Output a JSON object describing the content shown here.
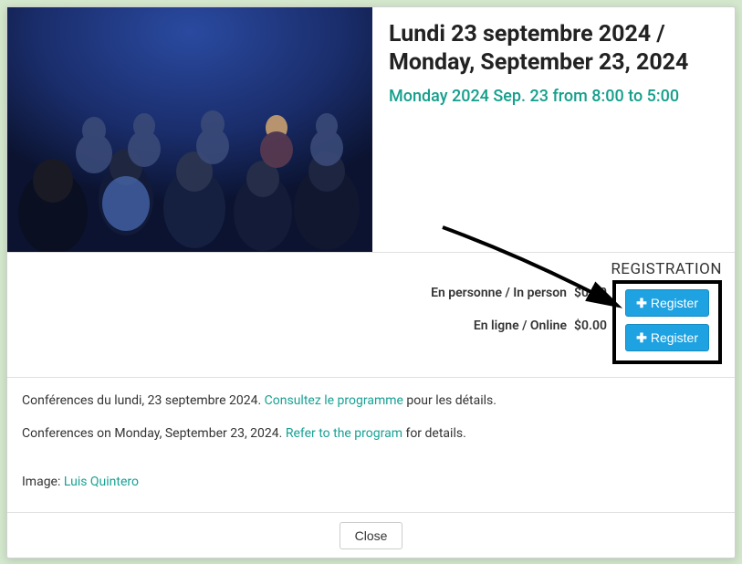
{
  "header": {
    "title": "Lundi 23 septembre 2024 / Monday, September 23, 2024",
    "datetime": "Monday 2024 Sep. 23 from 8:00 to 5:00"
  },
  "registration": {
    "heading": "REGISTRATION",
    "options": [
      {
        "label": "En personne / In person",
        "price": "$0.00",
        "button": "Register"
      },
      {
        "label": "En ligne / Online",
        "price": "$0.00",
        "button": "Register"
      }
    ]
  },
  "description": {
    "line_fr_prefix": "Conférences du lundi, 23 septembre 2024. ",
    "link_fr": "Consultez le programme",
    "line_fr_suffix": " pour les détails.",
    "line_en_prefix": "Conferences on Monday, September 23, 2024. ",
    "link_en": "Refer to the program",
    "line_en_suffix": " for details.",
    "image_credit_prefix": "Image: ",
    "image_credit_link": "Luis Quintero"
  },
  "footer": {
    "close_label": "Close"
  },
  "colors": {
    "accent_teal": "#159f8c",
    "button_blue": "#1ea2e1"
  }
}
